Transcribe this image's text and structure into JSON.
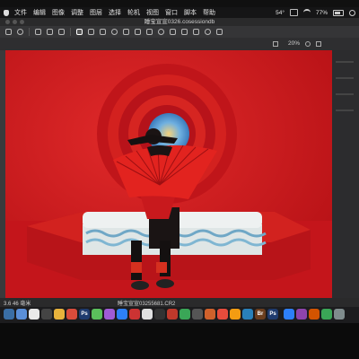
{
  "menubar": {
    "items": [
      "文件",
      "编辑",
      "图像",
      "调整",
      "图层",
      "选择",
      "轮机",
      "视图",
      "窗口",
      "脚本",
      "帮助"
    ],
    "temperature": "54°",
    "battery": "77%",
    "wifi_icon": "wifi-icon",
    "apple_icon": "apple-icon"
  },
  "window": {
    "title": "睡宝宣宣0326.cosessiondb"
  },
  "toolbar": {
    "icons": [
      "crop-icon",
      "rotate-icon",
      "cursor-icon",
      "hand-icon",
      "zoom-icon",
      "pen-icon",
      "brush-icon",
      "eraser-icon",
      "clone-icon",
      "heal-icon",
      "mask-icon",
      "gradient-icon"
    ]
  },
  "subbar": {
    "zoom_label": "20%"
  },
  "photo": {
    "description_colors": {
      "background": "#c8161b",
      "mattress": "#e9ecec",
      "fan": "#e2231f"
    }
  },
  "status": {
    "left_text": "3.6  46 毫米",
    "file_name": "睡宝宣宣03255681.CR2"
  },
  "dock": {
    "labels": [
      "Ps",
      "Br",
      "Ps"
    ],
    "colors": [
      "#3a6ea5",
      "#5a8fd8",
      "#e9e9e9",
      "#444",
      "#d94c3b",
      "#5bbf5b",
      "#a05bd6",
      "#e8b33c",
      "#2d7ff9",
      "#cc3333"
    ]
  }
}
